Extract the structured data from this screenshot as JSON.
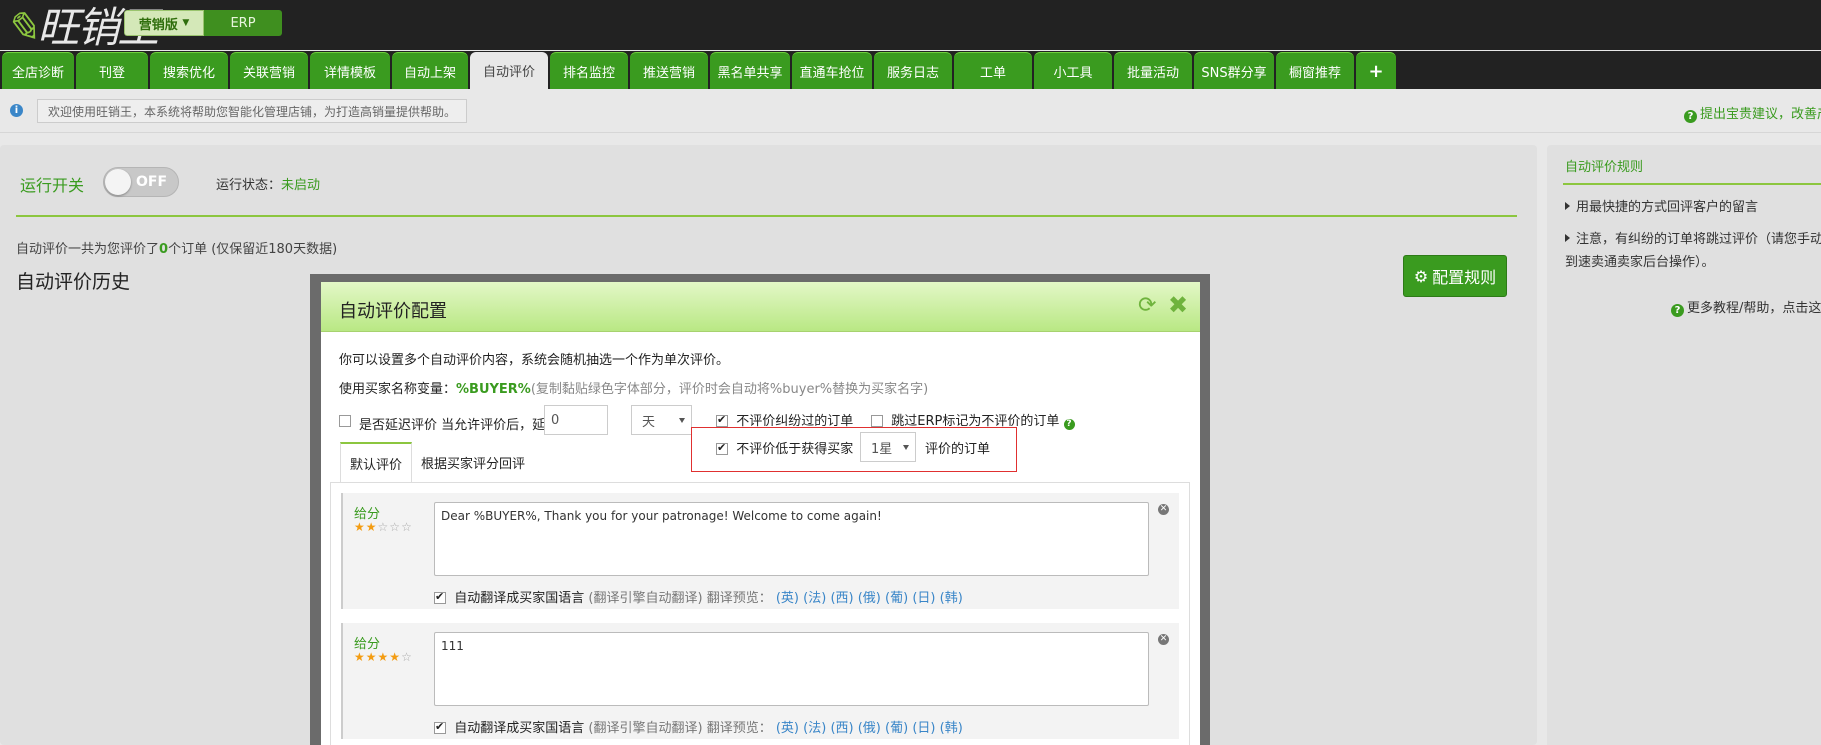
{
  "header": {
    "logo": "旺销王",
    "version_switch": {
      "active": "营销版",
      "other": "ERP"
    }
  },
  "tabs": [
    "全店诊断",
    "刊登",
    "搜索优化",
    "关联营销",
    "详情模板",
    "自动上架",
    "自动评价",
    "排名监控",
    "推送营销",
    "黑名单共享",
    "直通车抢位",
    "服务日志",
    "工单",
    "小工具",
    "批量活动",
    "SNS群分享",
    "橱窗推荐",
    "+"
  ],
  "active_tab": "自动评价",
  "notice": {
    "message": "欢迎使用旺销王，本系统将帮助您智能化管理店铺，为打造高销量提供帮助。",
    "suggest": "提出宝贵建议，改善产"
  },
  "main": {
    "run_label": "运行开关",
    "toggle_text": "OFF",
    "status_label": "运行状态：",
    "status_value": "未启动",
    "summary_pre": "自动评价一共为您评价了",
    "summary_count": "0",
    "summary_post": "个订单 (仅保留近180天数据)",
    "history_title": "自动评价历史",
    "config_button": "配置规则"
  },
  "sidebar": {
    "title": "自动评价规则",
    "item1": "用最快捷的方式回评客户的留言",
    "item2": "注意，有纠纷的订单将跳过评价（请您手动到速卖通卖家后台操作）。",
    "more": "更多教程/帮助，点击这里"
  },
  "modal": {
    "title": "自动评价配置",
    "line1": "你可以设置多个自动评价内容，系统会随机抽选一个作为单次评价。",
    "line2_label": "使用买家名称变量：",
    "line2_var": "%BUYER%",
    "line2_note": "(复制黏贴绿色字体部分，评价时会自动将%buyer%替换为买家名字)",
    "delay_label": "是否延迟评价 当允许评价后，延迟",
    "delay_value": "0",
    "delay_unit": "天",
    "dispute_label": "不评价纠纷过的订单",
    "skip_erp_label": "跳过ERP标记为不评价的订单",
    "low_star_label": "不评价低于获得买家",
    "low_star_value": "1星",
    "low_star_tail": "评价的订单",
    "subtabs": [
      "默认评价",
      "根据买家评分回评"
    ],
    "items": [
      {
        "score_label": "给分",
        "rating": 2,
        "text": "Dear %BUYER%, Thank you for your patronage! Welcome to come again!",
        "translate_label": "自动翻译成买家国语言",
        "translate_note": "(翻译引擎自动翻译) 翻译预览：",
        "langs": [
          "(英)",
          "(法)",
          "(西)",
          "(俄)",
          "(葡)",
          "(日)",
          "(韩)"
        ]
      },
      {
        "score_label": "给分",
        "rating": 4,
        "text": "111",
        "translate_label": "自动翻译成买家国语言",
        "translate_note": "(翻译引擎自动翻译) 翻译预览：",
        "langs": [
          "(英)",
          "(法)",
          "(西)",
          "(俄)",
          "(葡)",
          "(日)",
          "(韩)"
        ]
      }
    ]
  }
}
